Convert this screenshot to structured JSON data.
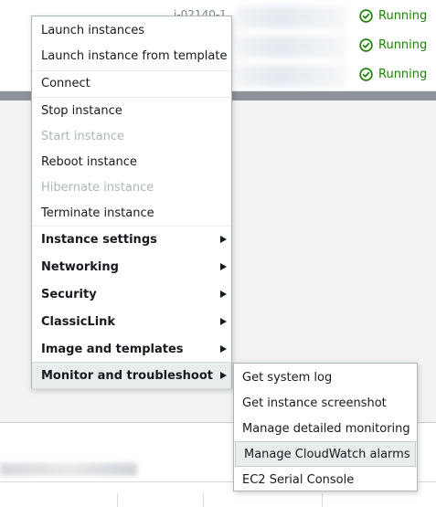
{
  "instances": {
    "rows": [
      {
        "id_fragment": "i-02140-1",
        "status": "Running"
      },
      {
        "id_fragment": "",
        "status": "Running"
      },
      {
        "id_fragment": "",
        "status": "Running"
      }
    ],
    "status_color": "#1d8102"
  },
  "context_menu": {
    "items": [
      {
        "label": "Launch instances",
        "state": "enabled"
      },
      {
        "label": "Launch instance from template",
        "state": "enabled"
      },
      {
        "label": "Connect",
        "state": "enabled"
      },
      {
        "label": "Stop instance",
        "state": "enabled"
      },
      {
        "label": "Start instance",
        "state": "disabled"
      },
      {
        "label": "Reboot instance",
        "state": "enabled"
      },
      {
        "label": "Hibernate instance",
        "state": "disabled"
      },
      {
        "label": "Terminate instance",
        "state": "enabled"
      },
      {
        "label": "Instance settings",
        "submenu": true
      },
      {
        "label": "Networking",
        "submenu": true
      },
      {
        "label": "Security",
        "submenu": true
      },
      {
        "label": "ClassicLink",
        "submenu": true
      },
      {
        "label": "Image and templates",
        "submenu": true
      },
      {
        "label": "Monitor and troubleshoot",
        "submenu": true,
        "active": true
      }
    ]
  },
  "submenu": {
    "items": [
      {
        "label": "Get system log"
      },
      {
        "label": "Get instance screenshot"
      },
      {
        "label": "Manage detailed monitoring"
      },
      {
        "label": "Manage CloudWatch alarms",
        "hovered": true
      },
      {
        "label": "EC2 Serial Console"
      }
    ]
  },
  "colors": {
    "disabled_text": "#aab7b8",
    "menu_border": "#aab7b8",
    "hover_bg": "#eaeded"
  }
}
